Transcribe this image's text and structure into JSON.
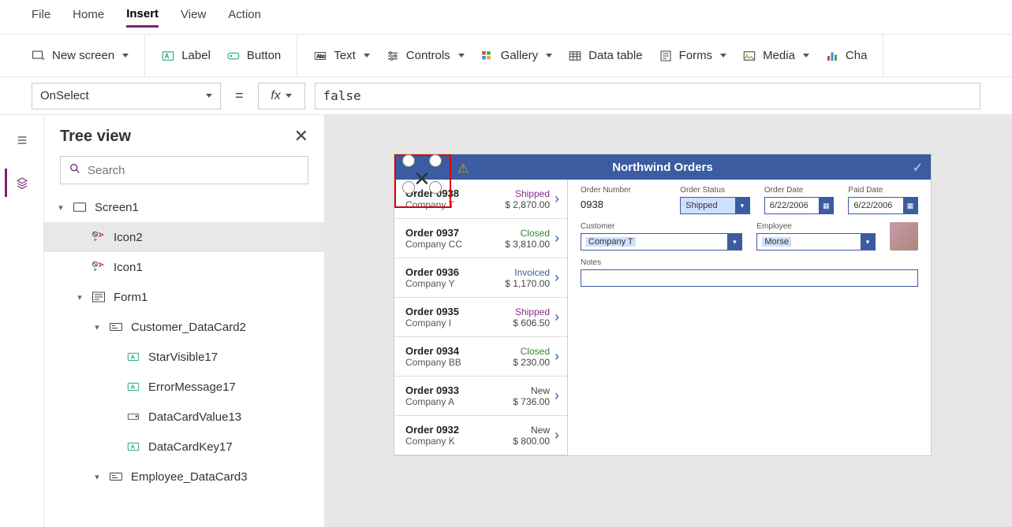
{
  "menu": {
    "tabs": [
      "File",
      "Home",
      "Insert",
      "View",
      "Action"
    ],
    "active": "Insert"
  },
  "ribbon": {
    "new_screen": "New screen",
    "label": "Label",
    "button": "Button",
    "text": "Text",
    "controls": "Controls",
    "gallery": "Gallery",
    "data_table": "Data table",
    "forms": "Forms",
    "media": "Media",
    "cha": "Cha"
  },
  "formula": {
    "property": "OnSelect",
    "fx": "fx",
    "value": "false"
  },
  "tree_panel": {
    "title": "Tree view",
    "search_placeholder": "Search"
  },
  "tree": {
    "screen1": "Screen1",
    "icon2": "Icon2",
    "icon1": "Icon1",
    "form1": "Form1",
    "customer_dc": "Customer_DataCard2",
    "starvisible": "StarVisible17",
    "errormessage": "ErrorMessage17",
    "datacardvalue": "DataCardValue13",
    "datacardkey": "DataCardKey17",
    "employee_dc": "Employee_DataCard3"
  },
  "app": {
    "title": "Northwind Orders",
    "orders": [
      {
        "title": "Order 0938",
        "company": "Company T",
        "status": "Shipped",
        "amount": "$ 2,870.00"
      },
      {
        "title": "Order 0937",
        "company": "Company CC",
        "status": "Closed",
        "amount": "$ 3,810.00"
      },
      {
        "title": "Order 0936",
        "company": "Company Y",
        "status": "Invoiced",
        "amount": "$ 1,170.00"
      },
      {
        "title": "Order 0935",
        "company": "Company I",
        "status": "Shipped",
        "amount": "$ 606.50"
      },
      {
        "title": "Order 0934",
        "company": "Company BB",
        "status": "Closed",
        "amount": "$ 230.00"
      },
      {
        "title": "Order 0933",
        "company": "Company A",
        "status": "New",
        "amount": "$ 736.00"
      },
      {
        "title": "Order 0932",
        "company": "Company K",
        "status": "New",
        "amount": "$ 800.00"
      }
    ],
    "form": {
      "order_number_label": "Order Number",
      "order_number": "0938",
      "order_status_label": "Order Status",
      "order_status": "Shipped",
      "order_date_label": "Order Date",
      "order_date": "6/22/2006",
      "paid_date_label": "Paid Date",
      "paid_date": "6/22/2006",
      "customer_label": "Customer",
      "customer": "Company T",
      "employee_label": "Employee",
      "employee": "Morse",
      "notes_label": "Notes"
    }
  }
}
